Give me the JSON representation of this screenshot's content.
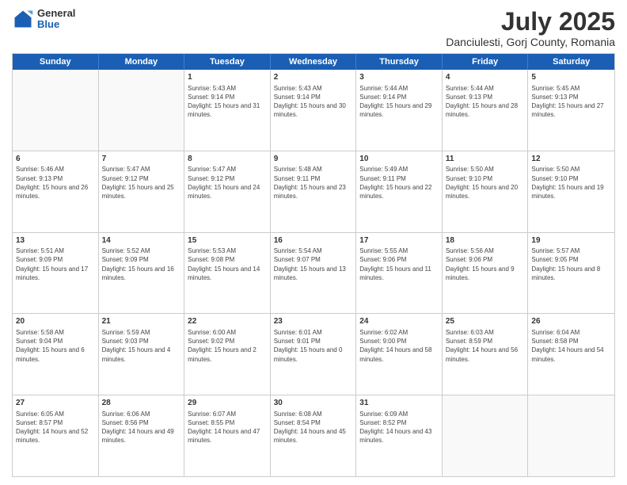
{
  "logo": {
    "general": "General",
    "blue": "Blue"
  },
  "title": "July 2025",
  "subtitle": "Danciulesti, Gorj County, Romania",
  "days": [
    "Sunday",
    "Monday",
    "Tuesday",
    "Wednesday",
    "Thursday",
    "Friday",
    "Saturday"
  ],
  "rows": [
    [
      {
        "day": "",
        "empty": true
      },
      {
        "day": "",
        "empty": true
      },
      {
        "day": "1",
        "sunrise": "Sunrise: 5:43 AM",
        "sunset": "Sunset: 9:14 PM",
        "daylight": "Daylight: 15 hours and 31 minutes."
      },
      {
        "day": "2",
        "sunrise": "Sunrise: 5:43 AM",
        "sunset": "Sunset: 9:14 PM",
        "daylight": "Daylight: 15 hours and 30 minutes."
      },
      {
        "day": "3",
        "sunrise": "Sunrise: 5:44 AM",
        "sunset": "Sunset: 9:14 PM",
        "daylight": "Daylight: 15 hours and 29 minutes."
      },
      {
        "day": "4",
        "sunrise": "Sunrise: 5:44 AM",
        "sunset": "Sunset: 9:13 PM",
        "daylight": "Daylight: 15 hours and 28 minutes."
      },
      {
        "day": "5",
        "sunrise": "Sunrise: 5:45 AM",
        "sunset": "Sunset: 9:13 PM",
        "daylight": "Daylight: 15 hours and 27 minutes."
      }
    ],
    [
      {
        "day": "6",
        "sunrise": "Sunrise: 5:46 AM",
        "sunset": "Sunset: 9:13 PM",
        "daylight": "Daylight: 15 hours and 26 minutes."
      },
      {
        "day": "7",
        "sunrise": "Sunrise: 5:47 AM",
        "sunset": "Sunset: 9:12 PM",
        "daylight": "Daylight: 15 hours and 25 minutes."
      },
      {
        "day": "8",
        "sunrise": "Sunrise: 5:47 AM",
        "sunset": "Sunset: 9:12 PM",
        "daylight": "Daylight: 15 hours and 24 minutes."
      },
      {
        "day": "9",
        "sunrise": "Sunrise: 5:48 AM",
        "sunset": "Sunset: 9:11 PM",
        "daylight": "Daylight: 15 hours and 23 minutes."
      },
      {
        "day": "10",
        "sunrise": "Sunrise: 5:49 AM",
        "sunset": "Sunset: 9:11 PM",
        "daylight": "Daylight: 15 hours and 22 minutes."
      },
      {
        "day": "11",
        "sunrise": "Sunrise: 5:50 AM",
        "sunset": "Sunset: 9:10 PM",
        "daylight": "Daylight: 15 hours and 20 minutes."
      },
      {
        "day": "12",
        "sunrise": "Sunrise: 5:50 AM",
        "sunset": "Sunset: 9:10 PM",
        "daylight": "Daylight: 15 hours and 19 minutes."
      }
    ],
    [
      {
        "day": "13",
        "sunrise": "Sunrise: 5:51 AM",
        "sunset": "Sunset: 9:09 PM",
        "daylight": "Daylight: 15 hours and 17 minutes."
      },
      {
        "day": "14",
        "sunrise": "Sunrise: 5:52 AM",
        "sunset": "Sunset: 9:09 PM",
        "daylight": "Daylight: 15 hours and 16 minutes."
      },
      {
        "day": "15",
        "sunrise": "Sunrise: 5:53 AM",
        "sunset": "Sunset: 9:08 PM",
        "daylight": "Daylight: 15 hours and 14 minutes."
      },
      {
        "day": "16",
        "sunrise": "Sunrise: 5:54 AM",
        "sunset": "Sunset: 9:07 PM",
        "daylight": "Daylight: 15 hours and 13 minutes."
      },
      {
        "day": "17",
        "sunrise": "Sunrise: 5:55 AM",
        "sunset": "Sunset: 9:06 PM",
        "daylight": "Daylight: 15 hours and 11 minutes."
      },
      {
        "day": "18",
        "sunrise": "Sunrise: 5:56 AM",
        "sunset": "Sunset: 9:06 PM",
        "daylight": "Daylight: 15 hours and 9 minutes."
      },
      {
        "day": "19",
        "sunrise": "Sunrise: 5:57 AM",
        "sunset": "Sunset: 9:05 PM",
        "daylight": "Daylight: 15 hours and 8 minutes."
      }
    ],
    [
      {
        "day": "20",
        "sunrise": "Sunrise: 5:58 AM",
        "sunset": "Sunset: 9:04 PM",
        "daylight": "Daylight: 15 hours and 6 minutes."
      },
      {
        "day": "21",
        "sunrise": "Sunrise: 5:59 AM",
        "sunset": "Sunset: 9:03 PM",
        "daylight": "Daylight: 15 hours and 4 minutes."
      },
      {
        "day": "22",
        "sunrise": "Sunrise: 6:00 AM",
        "sunset": "Sunset: 9:02 PM",
        "daylight": "Daylight: 15 hours and 2 minutes."
      },
      {
        "day": "23",
        "sunrise": "Sunrise: 6:01 AM",
        "sunset": "Sunset: 9:01 PM",
        "daylight": "Daylight: 15 hours and 0 minutes."
      },
      {
        "day": "24",
        "sunrise": "Sunrise: 6:02 AM",
        "sunset": "Sunset: 9:00 PM",
        "daylight": "Daylight: 14 hours and 58 minutes."
      },
      {
        "day": "25",
        "sunrise": "Sunrise: 6:03 AM",
        "sunset": "Sunset: 8:59 PM",
        "daylight": "Daylight: 14 hours and 56 minutes."
      },
      {
        "day": "26",
        "sunrise": "Sunrise: 6:04 AM",
        "sunset": "Sunset: 8:58 PM",
        "daylight": "Daylight: 14 hours and 54 minutes."
      }
    ],
    [
      {
        "day": "27",
        "sunrise": "Sunrise: 6:05 AM",
        "sunset": "Sunset: 8:57 PM",
        "daylight": "Daylight: 14 hours and 52 minutes."
      },
      {
        "day": "28",
        "sunrise": "Sunrise: 6:06 AM",
        "sunset": "Sunset: 8:56 PM",
        "daylight": "Daylight: 14 hours and 49 minutes."
      },
      {
        "day": "29",
        "sunrise": "Sunrise: 6:07 AM",
        "sunset": "Sunset: 8:55 PM",
        "daylight": "Daylight: 14 hours and 47 minutes."
      },
      {
        "day": "30",
        "sunrise": "Sunrise: 6:08 AM",
        "sunset": "Sunset: 8:54 PM",
        "daylight": "Daylight: 14 hours and 45 minutes."
      },
      {
        "day": "31",
        "sunrise": "Sunrise: 6:09 AM",
        "sunset": "Sunset: 8:52 PM",
        "daylight": "Daylight: 14 hours and 43 minutes."
      },
      {
        "day": "",
        "empty": true
      },
      {
        "day": "",
        "empty": true
      }
    ]
  ]
}
